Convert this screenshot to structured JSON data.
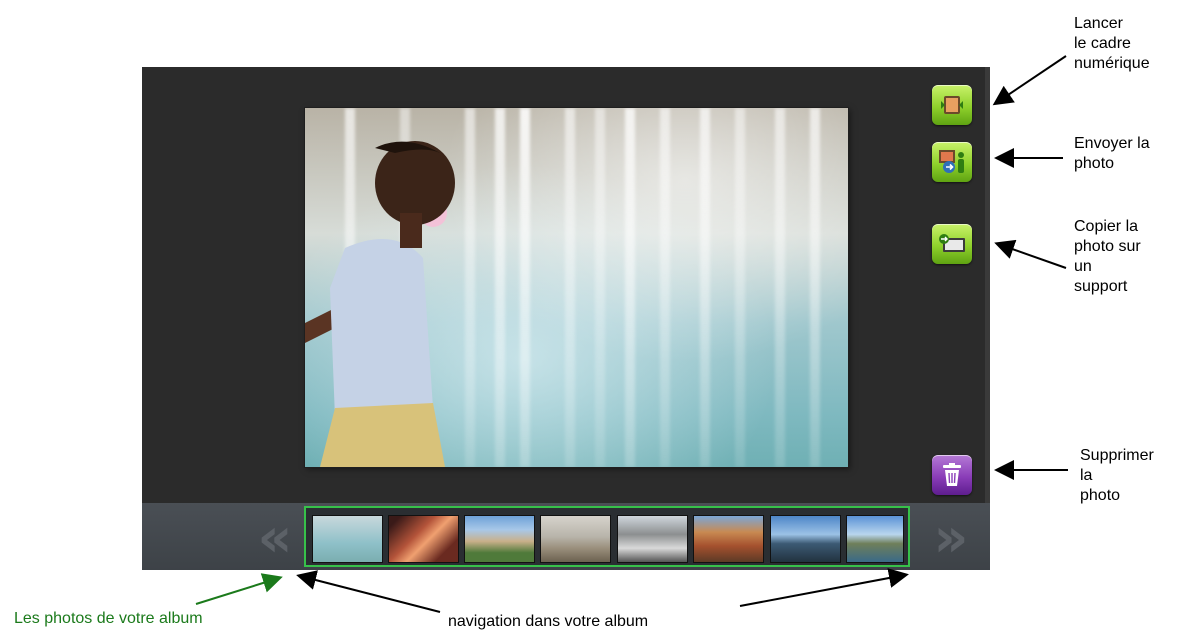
{
  "annotations": {
    "launch_frame": [
      "Lancer",
      "le cadre",
      "numérique"
    ],
    "send_photo": [
      "Envoyer la",
      "photo"
    ],
    "copy_photo": [
      "Copier la",
      "photo sur",
      "un",
      "support"
    ],
    "delete_photo": [
      "Supprimer",
      "la",
      "photo"
    ],
    "album_photos": "Les photos de votre album",
    "album_navigation": "navigation dans votre album"
  },
  "side_buttons": [
    {
      "icon": "digital-frame-icon",
      "color": "green"
    },
    {
      "icon": "send-photo-icon",
      "color": "green"
    },
    {
      "icon": "copy-to-media-icon",
      "color": "green"
    },
    {
      "icon": "trash-icon",
      "color": "purple"
    }
  ],
  "filmstrip": {
    "previous_glyph": "«",
    "next_glyph": "»",
    "thumbnails": [
      {
        "subject": "fountain"
      },
      {
        "subject": "canyon-rock"
      },
      {
        "subject": "houses"
      },
      {
        "subject": "beach"
      },
      {
        "subject": "city-street"
      },
      {
        "subject": "grand-canyon"
      },
      {
        "subject": "bridge"
      },
      {
        "subject": "castle-lake"
      }
    ]
  },
  "colors": {
    "app_background": "#2b2b2b",
    "filmstrip_highlight": "#37c14a",
    "album_label": "#1b7a1b",
    "button_green": "#8fd12c",
    "button_purple": "#8a3db8"
  }
}
